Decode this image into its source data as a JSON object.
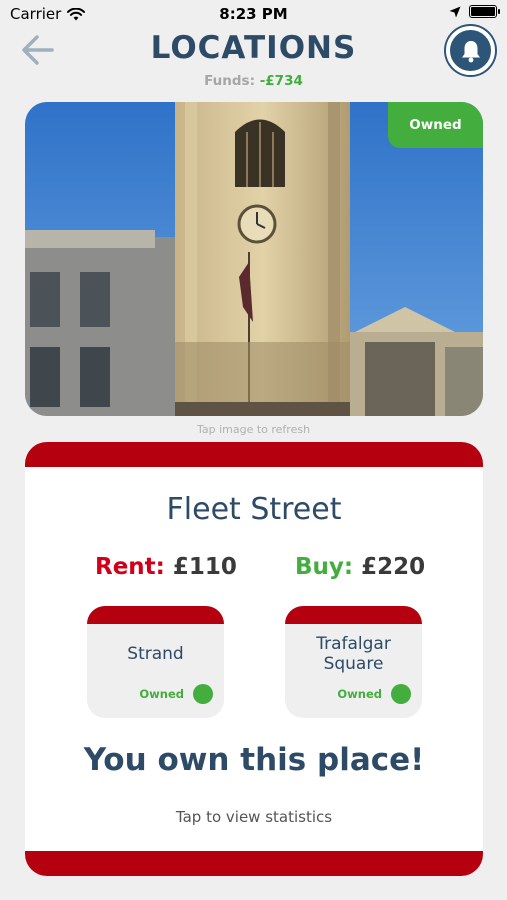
{
  "status_bar": {
    "carrier": "Carrier",
    "time": "8:23 PM"
  },
  "header": {
    "title": "LOCATIONS",
    "funds_label": "Funds:",
    "funds_value": "-£734"
  },
  "photo": {
    "badge": "Owned",
    "hint": "Tap image to refresh"
  },
  "location": {
    "name": "Fleet Street",
    "rent_label": "Rent:",
    "rent_value": "£110",
    "buy_label": "Buy:",
    "buy_value": "£220",
    "neighbours": [
      {
        "name": "Strand",
        "status": "Owned"
      },
      {
        "name": "Trafalgar Square",
        "status": "Owned"
      }
    ],
    "ownership_message": "You own this place!",
    "stats_link": "Tap to view statistics"
  },
  "colors": {
    "primary_blue": "#2d4a66",
    "accent_red": "#b5000f",
    "owned_green": "#43ae3e",
    "rent_red": "#d1001a"
  },
  "icons": [
    "back-arrow-icon",
    "bell-icon",
    "wifi-icon",
    "location-arrow-icon",
    "battery-icon"
  ]
}
